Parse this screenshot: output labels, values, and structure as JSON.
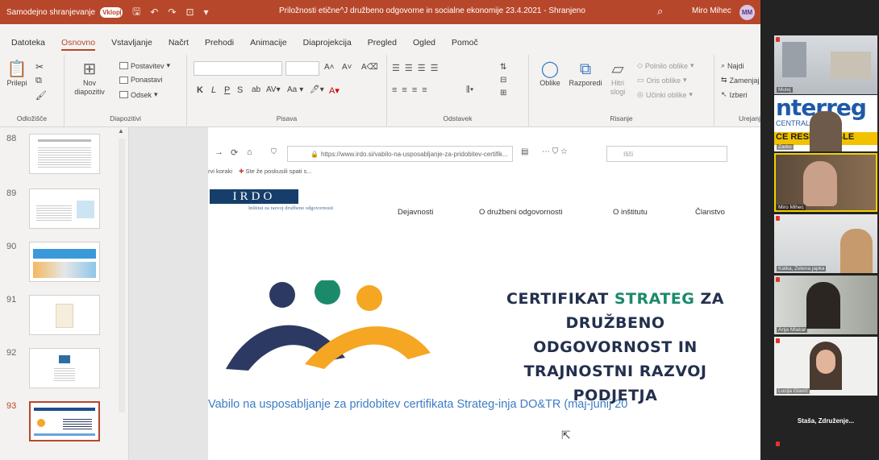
{
  "titlebar": {
    "autosave": "Samodejno shranjevanje",
    "toggle": "Vklop",
    "doc_title": "Priložnosti etične^J družbeno odgovorne in socialne ekonomije 23.4.2021 - Shranjeno",
    "user": "Miro Mihec",
    "initials": "MM"
  },
  "menu": [
    "Datoteka",
    "Osnovno",
    "Vstavljanje",
    "Načrt",
    "Prehodi",
    "Animacije",
    "Diaprojekcija",
    "Pregled",
    "Ogled",
    "Pomoč"
  ],
  "ribbon": {
    "clipboard": {
      "paste": "Prilepi",
      "label": "Odložišče"
    },
    "slides": {
      "new": "Nov diapozitiv",
      "layout": "Postavitev",
      "reset": "Ponastavi",
      "section": "Odsek",
      "label": "Diapozitivi"
    },
    "font": {
      "label": "Pisava",
      "bold": "K",
      "italic": "L",
      "underline": "P",
      "strike": "S",
      "case": "Aa"
    },
    "paragraph": {
      "label": "Odstavek"
    },
    "drawing": {
      "shapes": "Oblike",
      "arrange": "Razporedi",
      "quick": "Hitri slogi",
      "fill": "Polnilo oblike",
      "outline": "Oris oblike",
      "effects": "Učinki oblike",
      "label": "Risanje"
    },
    "editing": {
      "find": "Najdi",
      "replace": "Zamenjaj",
      "select": "Izberi",
      "label": "Urejanje"
    }
  },
  "thumbnails": [
    {
      "num": "88"
    },
    {
      "num": "89"
    },
    {
      "num": "90"
    },
    {
      "num": "91"
    },
    {
      "num": "92"
    },
    {
      "num": "93"
    }
  ],
  "slide": {
    "url": "https://www.irdo.si/vabilo-na-usposabljanje-za-pridobitev-certifik...",
    "search": "Išči",
    "bookmark1": "rvi koraki",
    "bookmark2": "Ste že poskusili spati s...",
    "logo": "IRDO",
    "logo_sub": "Inštitut za razvoj družbene odgovornosti",
    "nav": [
      "Dejavnosti",
      "O družbeni odgovornosti",
      "O inštitutu",
      "Članstvo"
    ],
    "cert_line1a": "CERTIFIKAT ",
    "cert_line1b": "STRATEG",
    "cert_line1c": " ZA",
    "cert_line2": "DRUŽBENO ODGOVORNOST IN",
    "cert_line3": "TRAJNOSTNI RAZVOJ PODJETJA",
    "invite": "Vabilo na usposabljanje za pridobitev certifikata Strateg-inja DO&TR (maj-junij 20"
  },
  "gallery": {
    "p1": "Mulej",
    "banner1": "nterreg",
    "banner2": "CENTRAL EUROPE",
    "banner3": "CE RESPONSIBLE",
    "p2": "Zarko",
    "p3": "Miro Mihec",
    "p4": "Katka, Zelena japka",
    "p5": "Anja Mlakar",
    "p6": "Lucija Glavič",
    "p7": "Staša, Združenje..."
  }
}
